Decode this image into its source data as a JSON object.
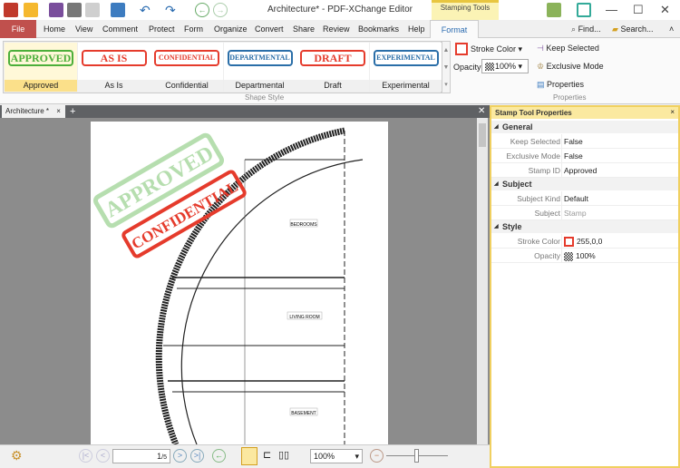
{
  "window": {
    "title": "Architecture* - PDF-XChange Editor",
    "context_tab": "Stamping Tools"
  },
  "menu": {
    "file": "File",
    "tabs": [
      "Home",
      "View",
      "Comment",
      "Protect",
      "Form",
      "Organize",
      "Convert",
      "Share",
      "Review",
      "Bookmarks",
      "Help"
    ],
    "active": "Format",
    "find": "Find...",
    "search": "Search..."
  },
  "ribbon": {
    "stamps": [
      {
        "text": "APPROVED",
        "label": "Approved",
        "color": "#4caf3a"
      },
      {
        "text": "AS IS",
        "label": "As Is",
        "color": "#e53b2c"
      },
      {
        "text": "CONFIDENTIAL",
        "label": "Confidential",
        "color": "#e53b2c"
      },
      {
        "text": "DEPARTMENTAL",
        "label": "Departmental",
        "color": "#2a6ea8"
      },
      {
        "text": "DRAFT",
        "label": "Draft",
        "color": "#e53b2c"
      },
      {
        "text": "EXPERIMENTAL",
        "label": "Experimental",
        "color": "#2a6ea8"
      }
    ],
    "shape_style": "Shape Style",
    "stroke_color": "Stroke Color",
    "opacity_label": "Opacity:",
    "opacity_value": "100%",
    "keep_selected": "Keep Selected",
    "exclusive_mode": "Exclusive Mode",
    "properties": "Properties",
    "properties_group": "Properties"
  },
  "document": {
    "tab": "Architecture *",
    "stamps": [
      "APPROVED",
      "CONFIDENTIAL"
    ],
    "rooms": [
      "BEDROOMS",
      "LIVING ROOM",
      "BASEMENT"
    ]
  },
  "panel": {
    "title": "Stamp Tool Properties",
    "sections": [
      {
        "name": "General",
        "rows": [
          [
            "Keep Selected",
            "False"
          ],
          [
            "Exclusive Mode",
            "False"
          ],
          [
            "Stamp ID",
            "Approved"
          ]
        ]
      },
      {
        "name": "Subject",
        "rows": [
          [
            "Subject Kind",
            "Default"
          ],
          [
            "Subject",
            "Stamp"
          ]
        ]
      },
      {
        "name": "Style",
        "rows": [
          [
            "Stroke Color",
            "255,0,0"
          ],
          [
            "Opacity",
            "100%"
          ]
        ]
      }
    ]
  },
  "statusbar": {
    "page": "1",
    "page_total": "/5",
    "zoom": "100%",
    "zoom_level": 0.5
  }
}
